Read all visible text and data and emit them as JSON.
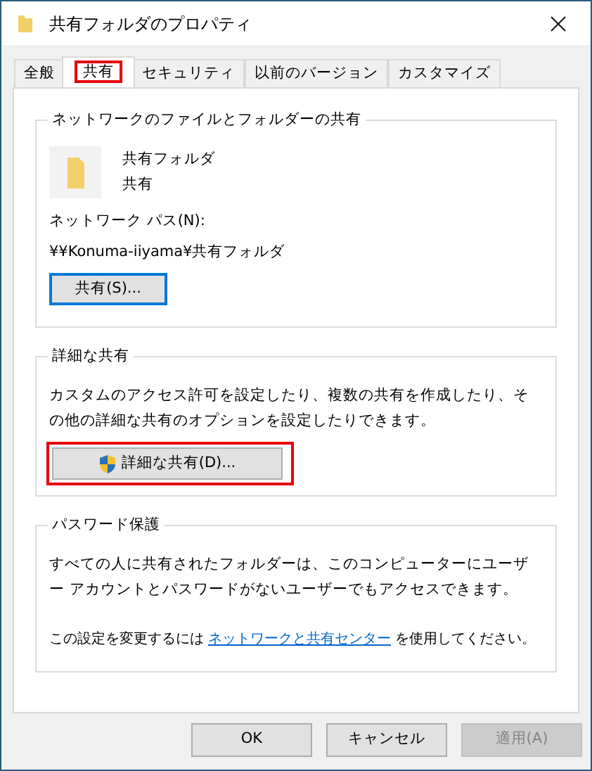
{
  "window": {
    "title": "共有フォルダのプロパティ"
  },
  "tabs": [
    {
      "label": "全般",
      "selected": false,
      "highlighted": false
    },
    {
      "label": "共有",
      "selected": true,
      "highlighted": true
    },
    {
      "label": "セキュリティ",
      "selected": false,
      "highlighted": false
    },
    {
      "label": "以前のバージョン",
      "selected": false,
      "highlighted": false
    },
    {
      "label": "カスタマイズ",
      "selected": false,
      "highlighted": false
    }
  ],
  "network_sharing": {
    "title": "ネットワークのファイルとフォルダーの共有",
    "folder_name": "共有フォルダ",
    "folder_status": "共有",
    "network_path_label": "ネットワーク パス(N):",
    "network_path": "¥¥Konuma-iiyama¥共有フォルダ",
    "share_button": {
      "label": "共有(S)...",
      "focused": true
    }
  },
  "advanced_sharing": {
    "title": "詳細な共有",
    "description": "カスタムのアクセス許可を設定したり、複数の共有を作成したり、その他の詳細な共有のオプションを設定したりできます。",
    "button": {
      "label": "詳細な共有(D)...",
      "highlighted": true
    }
  },
  "password_protection": {
    "title": "パスワード保護",
    "description": "すべての人に共有されたフォルダーは、このコンピューターにユーザー アカウントとパスワードがないユーザーでもアクセスできます。",
    "note_before": "この設定を変更するには",
    "link": "ネットワークと共有センター",
    "note_after": "を使用してください。"
  },
  "buttons": [
    {
      "label": "OK",
      "disabled": false
    },
    {
      "label": "キャンセル",
      "disabled": false
    },
    {
      "label": "適用(A)",
      "disabled": true
    }
  ]
}
